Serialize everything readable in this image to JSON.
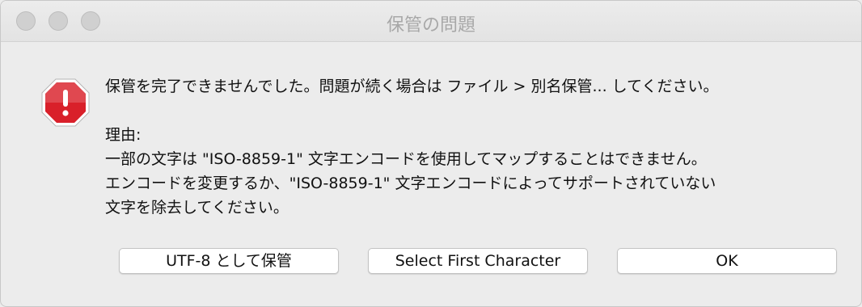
{
  "window": {
    "title": "保管の問題"
  },
  "alert": {
    "icon": "warning-octagon-icon",
    "icon_color": "#d9202a",
    "message": "保管を完了できませんでした。問題が続く場合は ファイル > 別名保管... してください。",
    "reason_label": "理由:",
    "reason_lines": [
      "一部の文字は \"ISO-8859-1\" 文字エンコードを使用してマップすることはできません。",
      "エンコードを変更するか、\"ISO-8859-1\" 文字エンコードによってサポートされていない",
      "文字を除去してください。"
    ]
  },
  "buttons": {
    "utf8": "UTF-8 として保管",
    "select_first": "Select First Character",
    "ok": "OK"
  }
}
